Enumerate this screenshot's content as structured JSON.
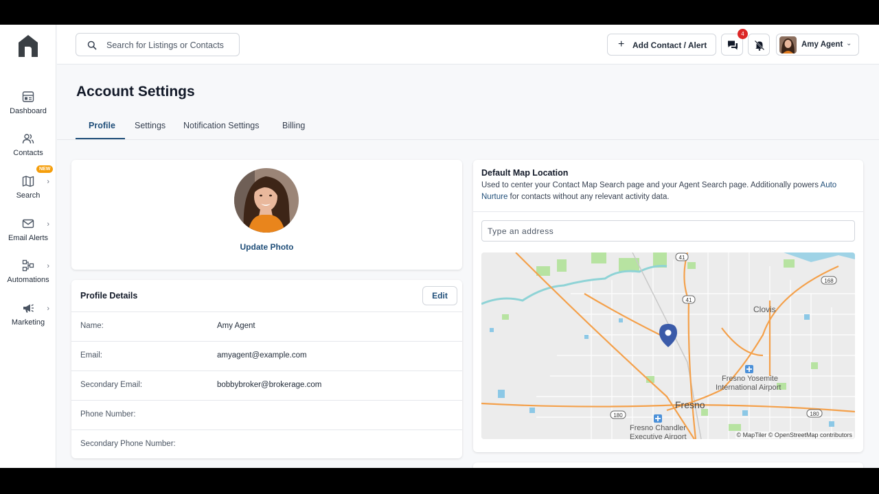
{
  "sidebar": {
    "items": [
      {
        "label": "Dashboard",
        "icon": "dashboard-icon"
      },
      {
        "label": "Contacts",
        "icon": "contacts-icon"
      },
      {
        "label": "Search",
        "icon": "map-icon",
        "badge": "NEW"
      },
      {
        "label": "Email Alerts",
        "icon": "mail-icon"
      },
      {
        "label": "Automations",
        "icon": "automation-icon"
      },
      {
        "label": "Marketing",
        "icon": "megaphone-icon"
      }
    ]
  },
  "header": {
    "search_placeholder": "Search for Listings or Contacts",
    "add_button_label": "Add Contact / Alert",
    "messages_count": "4",
    "user_name": "Amy Agent"
  },
  "page": {
    "title": "Account Settings",
    "tabs": [
      {
        "label": "Profile",
        "active": true
      },
      {
        "label": "Settings",
        "active": false
      },
      {
        "label": "Notification Settings",
        "active": false
      },
      {
        "label": "Billing",
        "active": false
      }
    ]
  },
  "photo_card": {
    "update_label": "Update Photo"
  },
  "profile_details": {
    "title": "Profile Details",
    "edit_label": "Edit",
    "rows": [
      {
        "label": "Name:",
        "value": "Amy Agent"
      },
      {
        "label": "Email:",
        "value": "amyagent@example.com"
      },
      {
        "label": "Secondary Email:",
        "value": "bobbybroker@brokerage.com"
      },
      {
        "label": "Phone Number:",
        "value": ""
      },
      {
        "label": "Secondary Phone Number:",
        "value": ""
      }
    ]
  },
  "map_location": {
    "title": "Default Map Location",
    "description_prefix": "Used to center your Contact Map Search page and your Agent Search page. Additionally powers ",
    "description_link": "Auto Nurture",
    "description_suffix": " for contacts without any relevant activity data.",
    "address_placeholder": "Type an address",
    "map_labels": {
      "clovis": "Clovis",
      "airport_1": "Fresno Yosemite",
      "airport_2": "International Airport",
      "fresno": "Fresno",
      "chandler_1": "Fresno Chandler",
      "chandler_2": "Executive Airport",
      "hwy_41a": "41",
      "hwy_41b": "41",
      "hwy_168": "168",
      "hwy_180a": "180",
      "hwy_180b": "180"
    },
    "attribution": "© MapTiler © OpenStreetMap contributors"
  },
  "colors": {
    "accent": "#1e4d78",
    "badge_red": "#dc2626",
    "new_badge": "#f59e0b",
    "map_pin": "#3b5ba9"
  }
}
